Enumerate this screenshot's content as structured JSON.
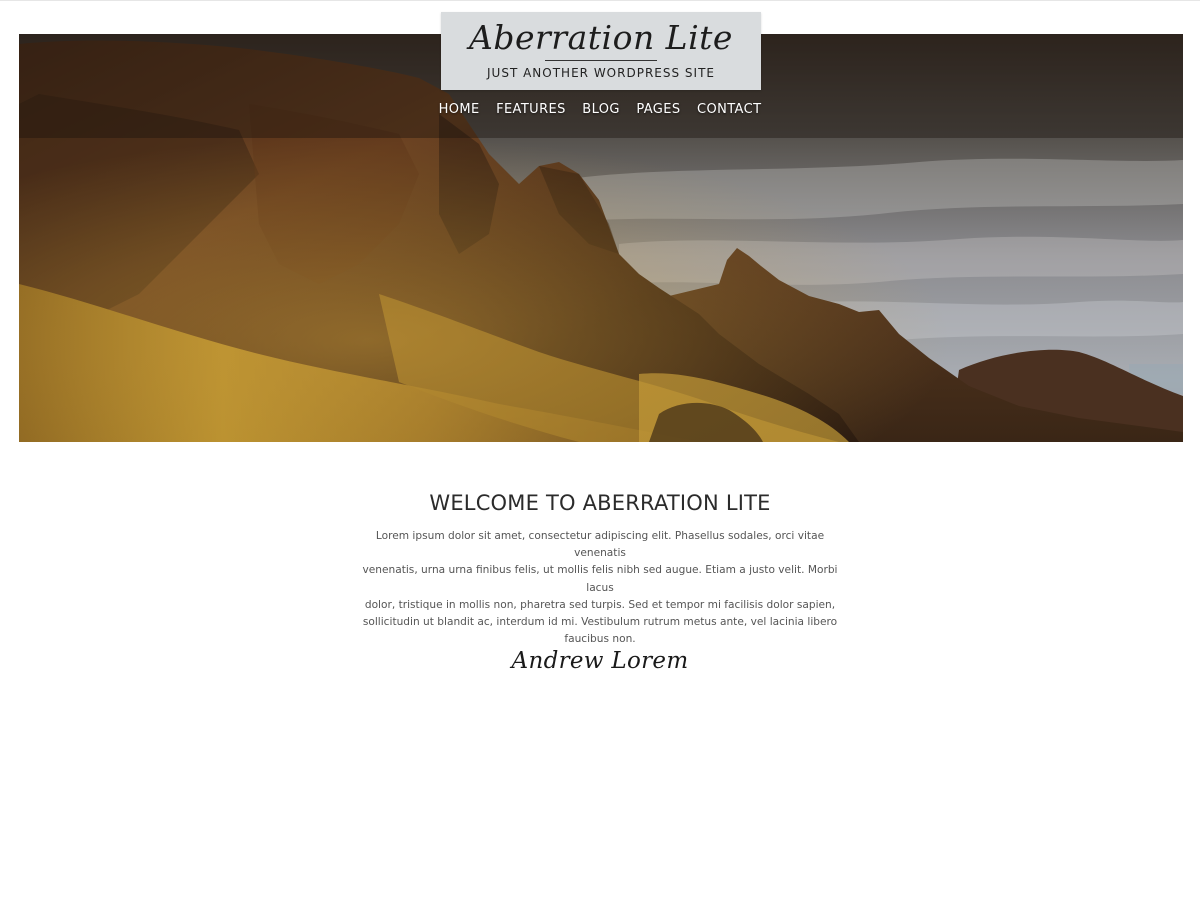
{
  "site": {
    "title": "Aberration Lite",
    "tagline": "JUST ANOTHER WORDPRESS SITE"
  },
  "nav": {
    "items": [
      {
        "label": "HOME"
      },
      {
        "label": "FEATURES"
      },
      {
        "label": "BLOG"
      },
      {
        "label": "PAGES"
      },
      {
        "label": "CONTACT"
      }
    ]
  },
  "intro": {
    "heading": "WELCOME TO ABERRATION LITE",
    "lines": [
      "Lorem ipsum dolor sit amet, consectetur adipiscing elit. Phasellus sodales, orci vitae venenatis",
      "venenatis, urna urna finibus felis, ut mollis felis nibh sed augue. Etiam a justo velit. Morbi lacus",
      "dolor, tristique in mollis non, pharetra sed turpis. Sed et tempor mi facilisis dolor sapien,",
      "sollicitudin ut blandit ac, interdum id mi. Vestibulum rutrum metus ante, vel lacinia libero",
      "faucibus non."
    ],
    "signature": "Andrew Lorem"
  },
  "colors": {
    "branding_bg": "#d9dcde",
    "nav_text": "#ffffff",
    "heading_text": "#2b2b2b",
    "body_text": "#555555"
  }
}
